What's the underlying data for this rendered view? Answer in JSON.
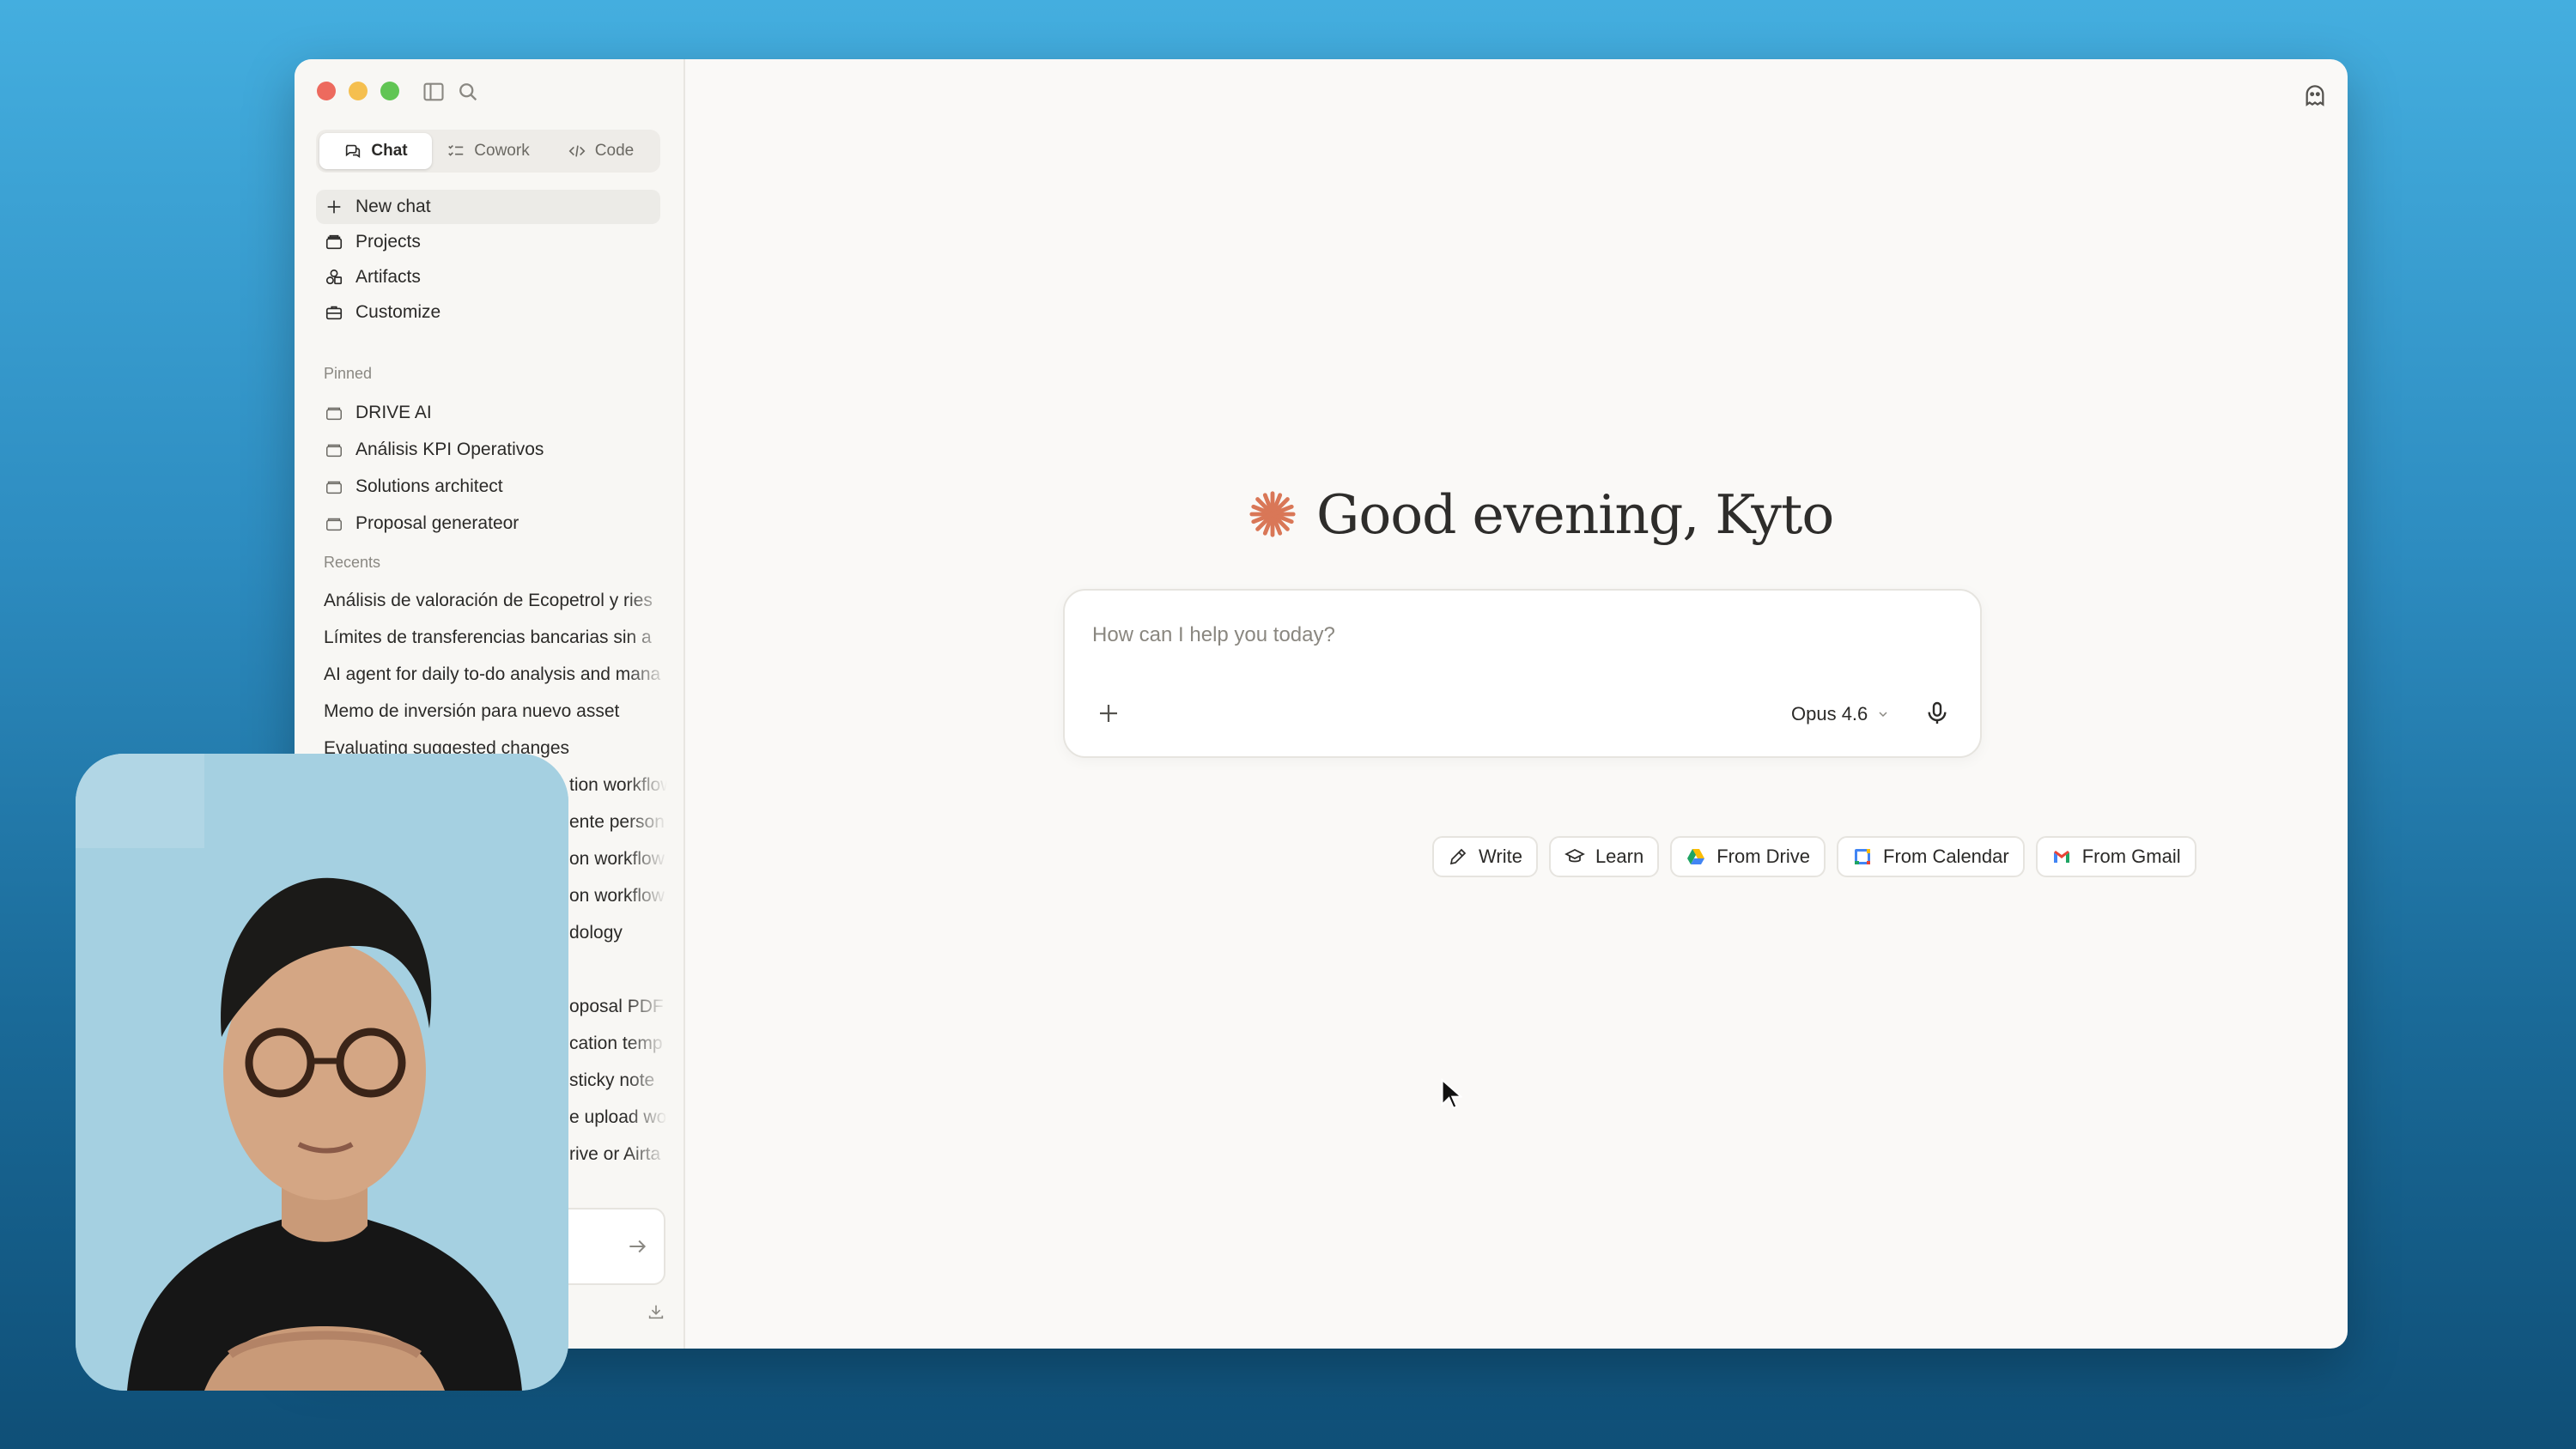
{
  "window": {
    "modes": [
      {
        "label": "Chat",
        "active": true
      },
      {
        "label": "Cowork",
        "active": false
      },
      {
        "label": "Code",
        "active": false
      }
    ],
    "nav": [
      {
        "label": "New chat",
        "icon": "plus-icon"
      },
      {
        "label": "Projects",
        "icon": "folder-icon"
      },
      {
        "label": "Artifacts",
        "icon": "shapes-icon"
      },
      {
        "label": "Customize",
        "icon": "briefcase-icon"
      }
    ],
    "pinned_label": "Pinned",
    "pinned": [
      {
        "label": "DRIVE AI"
      },
      {
        "label": "Análisis KPI Operativos"
      },
      {
        "label": "Solutions architect"
      },
      {
        "label": "Proposal generateor"
      }
    ],
    "recents_label": "Recents",
    "recents": [
      "Análisis de valoración de Ecopetrol y ries",
      "Límites de transferencias bancarias sin a",
      "AI agent for daily to-do analysis and mana",
      "Memo de inversión para nuevo asset",
      "Evaluating suggested changes",
      "tion workflow",
      "ente person",
      "on workflow",
      "on workflow",
      "dology",
      "",
      "oposal PDF",
      "cation temp",
      "sticky note",
      "e upload wo",
      "rive or Airta"
    ]
  },
  "main": {
    "greeting": "Good evening, Kyto",
    "composer": {
      "placeholder": "How can I help you today?",
      "model": "Opus 4.6"
    },
    "chips": [
      {
        "label": "Write",
        "icon": "pencil-icon"
      },
      {
        "label": "Learn",
        "icon": "graduation-cap-icon"
      },
      {
        "label": "From Drive",
        "icon": "google-drive-icon"
      },
      {
        "label": "From Calendar",
        "icon": "google-calendar-icon"
      },
      {
        "label": "From Gmail",
        "icon": "gmail-icon"
      }
    ]
  },
  "colors": {
    "accent": "#d97757",
    "background_top": "#44aedf",
    "background_bottom": "#0f4f77",
    "window": "#faf9f7",
    "sidebar": "#f8f7f4"
  }
}
